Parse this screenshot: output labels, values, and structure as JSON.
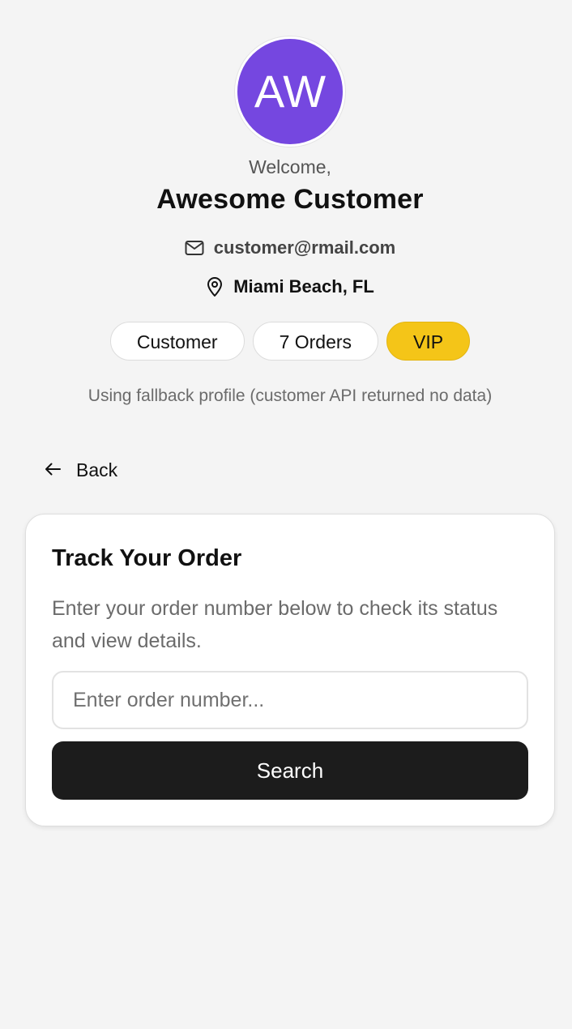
{
  "profile": {
    "initials": "AW",
    "avatar_color": "#7547e0",
    "welcome": "Welcome,",
    "name": "Awesome Customer",
    "email": "customer@rmail.com",
    "location": "Miami Beach, FL",
    "badges": {
      "role": "Customer",
      "orders": "7 Orders",
      "tier": "VIP",
      "tier_color": "#f4c518"
    },
    "fallback_note": "Using fallback profile (customer API returned no data)"
  },
  "nav": {
    "back_label": "Back",
    "back_icon": "arrow-left-icon"
  },
  "track_order": {
    "title": "Track Your Order",
    "description": "Enter your order number below to check its status and view details.",
    "input_value": "",
    "input_placeholder": "Enter order number...",
    "search_label": "Search",
    "button_color": "#1c1c1c"
  },
  "icons": {
    "email": "mail-icon",
    "location": "map-pin-icon"
  }
}
